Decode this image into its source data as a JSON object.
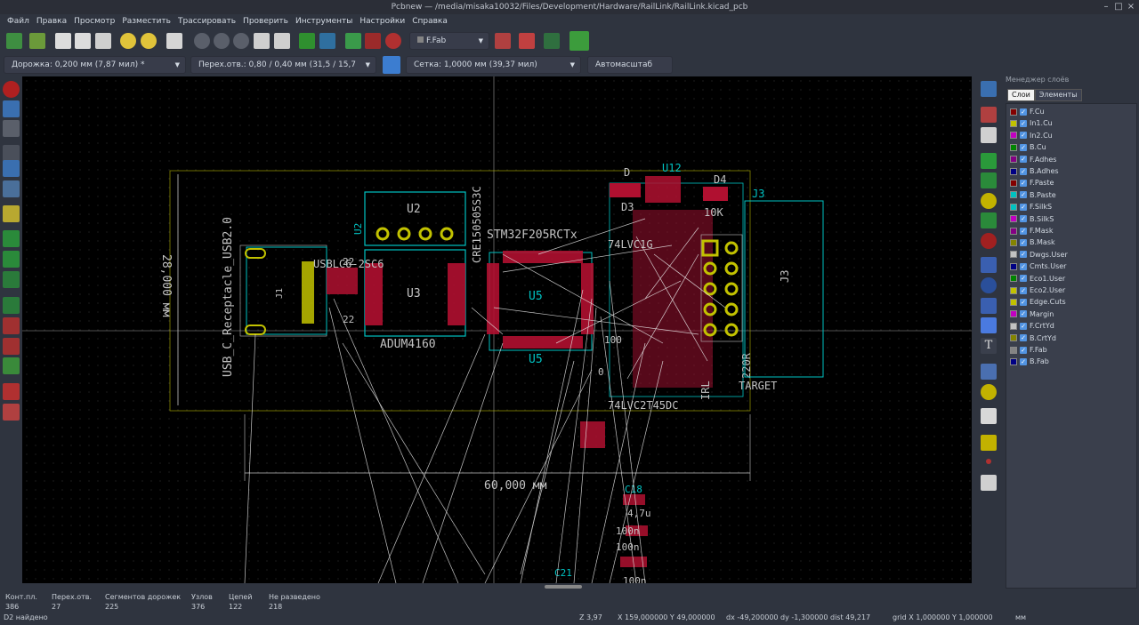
{
  "window": {
    "title": "Pcbnew — /media/misaka10032/Files/Development/Hardware/RailLink/RailLink.kicad_pcb"
  },
  "menu": [
    "Файл",
    "Правка",
    "Просмотр",
    "Разместить",
    "Трассировать",
    "Проверить",
    "Инструменты",
    "Настройки",
    "Справка"
  ],
  "toolbar": {
    "layer_select": "F.Fab",
    "icons": [
      "new-board-icon",
      "library-icon",
      "save-icon",
      "page-settings-icon",
      "print-icon",
      "plot-icon",
      "undo-icon",
      "redo-icon",
      "find-icon",
      "refresh-icon",
      "zoom-in-icon",
      "zoom-out-icon",
      "zoom-fit-icon",
      "zoom-selection-icon",
      "netlist-icon",
      "footprint-library-icon",
      "fabrication-icon",
      "erc-icon",
      "layer-select-icon",
      "drc-icon",
      "route-icon",
      "scripting-icon",
      "microwave-icon"
    ]
  },
  "toolbar2": {
    "track": "Дорожка: 0,200 мм (7,87 мил) *",
    "via": "Перех.отв.: 0,80 / 0,40 мм (31,5 / 15,7 мил) *",
    "grid": "Сетка: 1,0000 мм (39,37 мил)",
    "zoom": "Автомасштаб"
  },
  "left_tools": [
    "drc-off-icon",
    "grid-icon",
    "polar-icon",
    "units-inch-icon",
    "units-mm-icon",
    "cursor-shape-icon",
    "ratsnest-icon",
    "module-ratsnest-icon",
    "curved-ratsnest-icon",
    "zone-fill-icon",
    "zone-outline-icon",
    "zone-disable-icon",
    "pad-sketch-icon",
    "via-sketch-icon",
    "track-sketch-icon",
    "high-contrast-icon",
    "microwave-tools-icon"
  ],
  "right_tools": [
    "select-icon",
    "highlight-net-icon",
    "local-ratsnest-icon",
    "add-footprint-icon",
    "route-track-icon",
    "add-via-icon",
    "add-zone-icon",
    "add-keepout-icon",
    "add-line-icon",
    "add-circle-icon",
    "add-arc-icon",
    "add-polygon-icon",
    "add-text-icon",
    "add-dimension-icon",
    "add-target-icon",
    "delete-icon",
    "set-origin-icon",
    "grid-origin-icon",
    "measure-icon"
  ],
  "layers": {
    "title": "Менеджер слоёв",
    "tabs": [
      "Слои",
      "Элементы"
    ],
    "items": [
      {
        "name": "F.Cu",
        "color": "#840000"
      },
      {
        "name": "In1.Cu",
        "color": "#c2c200"
      },
      {
        "name": "In2.Cu",
        "color": "#c200c2"
      },
      {
        "name": "B.Cu",
        "color": "#008400"
      },
      {
        "name": "F.Adhes",
        "color": "#840084"
      },
      {
        "name": "B.Adhes",
        "color": "#000084"
      },
      {
        "name": "F.Paste",
        "color": "#840000"
      },
      {
        "name": "B.Paste",
        "color": "#00c2c2"
      },
      {
        "name": "F.SilkS",
        "color": "#00c2c2"
      },
      {
        "name": "B.SilkS",
        "color": "#c200c2"
      },
      {
        "name": "F.Mask",
        "color": "#840084"
      },
      {
        "name": "B.Mask",
        "color": "#848400"
      },
      {
        "name": "Dwgs.User",
        "color": "#c2c2c2"
      },
      {
        "name": "Cmts.User",
        "color": "#000084"
      },
      {
        "name": "Eco1.User",
        "color": "#008400"
      },
      {
        "name": "Eco2.User",
        "color": "#c2c200"
      },
      {
        "name": "Edge.Cuts",
        "color": "#c2c200"
      },
      {
        "name": "Margin",
        "color": "#c200c2"
      },
      {
        "name": "F.CrtYd",
        "color": "#c2c2c2"
      },
      {
        "name": "B.CrtYd",
        "color": "#848400"
      },
      {
        "name": "F.Fab",
        "color": "#848484"
      },
      {
        "name": "B.Fab",
        "color": "#000084"
      }
    ]
  },
  "pcb": {
    "labels": {
      "dim_h": "60,000 мм",
      "dim_v": "28,000 мм",
      "usb": "USB_C_Receptacle_USB2.0",
      "j1": "J1",
      "u2": "U2",
      "u2_side": "U2",
      "u3": "U3",
      "adum": "ADUM4160",
      "u5": "U5",
      "u5_bottom": "U5",
      "stm": "STM32F205RCTx",
      "cre": "CRE150505S3C",
      "usblc": "USBLC6-2SC6",
      "d": "D",
      "u12": "U12",
      "d4": "D4",
      "d3": "D3",
      "j3": "J3",
      "j3_top": "J3",
      "target": "TARGET",
      "chip74": "74LVC1G",
      "c18": "C18",
      "c21": "C21",
      "r10k": "10K",
      "r22a": "22",
      "r22b": "22",
      "r220r": "220R",
      "irl": "IRL",
      "logic": "74LVC2T45DC",
      "zero": "0",
      "n47u": "4,7u",
      "n100n": "100n",
      "n100na": "100n",
      "n100nb": "100n",
      "r100": "100"
    }
  },
  "status": {
    "stats": [
      {
        "label": "Конт.пл.",
        "value": "386"
      },
      {
        "label": "Перех.отв.",
        "value": "27"
      },
      {
        "label": "Сегментов дорожек",
        "value": "225"
      },
      {
        "label": "Узлов",
        "value": "376"
      },
      {
        "label": "Цепей",
        "value": "122"
      },
      {
        "label": "Не разведено",
        "value": "218"
      }
    ],
    "message": "D2 найдено",
    "zoom": "Z 3,97",
    "xy": "X 159,000000  Y 49,000000",
    "delta": "dx -49,200000  dy -1,300000  dist 49,217",
    "grid": "grid X 1,000000  Y 1,000000",
    "units": "мм"
  }
}
